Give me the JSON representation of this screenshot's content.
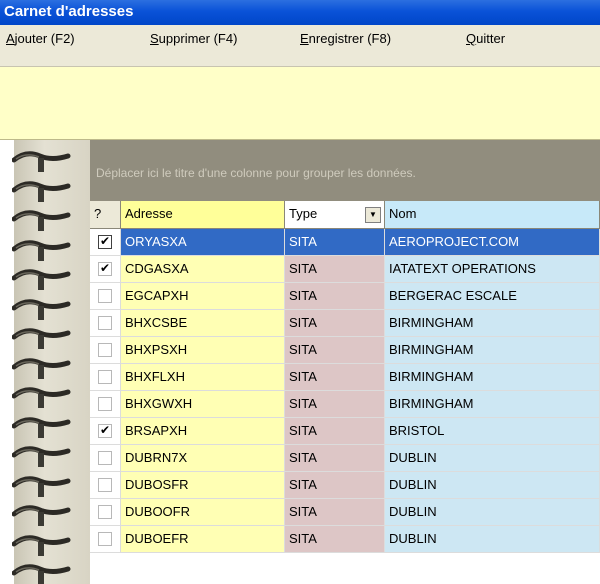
{
  "window": {
    "title": "Carnet d'adresses"
  },
  "menu": [
    {
      "key": "ajouter",
      "ul": "A",
      "rest": "jouter (F2)"
    },
    {
      "key": "supprimer",
      "ul": "S",
      "rest": "upprimer (F4)"
    },
    {
      "key": "enregistrer",
      "ul": "E",
      "rest": "nregistrer (F8)"
    },
    {
      "key": "quitter",
      "ul": "Q",
      "rest": "uitter"
    }
  ],
  "group_hint": "Déplacer ici le titre d'une colonne pour grouper les données.",
  "columns": {
    "check": "?",
    "adresse": "Adresse",
    "type": "Type",
    "nom": "Nom"
  },
  "rows": [
    {
      "checked": true,
      "selected": true,
      "adresse": "ORYASXA",
      "type": "SITA",
      "nom": "AEROPROJECT.COM"
    },
    {
      "checked": true,
      "selected": false,
      "adresse": "CDGASXA",
      "type": "SITA",
      "nom": "IATATEXT OPERATIONS"
    },
    {
      "checked": false,
      "selected": false,
      "adresse": "EGCAPXH",
      "type": "SITA",
      "nom": "BERGERAC ESCALE"
    },
    {
      "checked": false,
      "selected": false,
      "adresse": "BHXCSBE",
      "type": "SITA",
      "nom": "BIRMINGHAM"
    },
    {
      "checked": false,
      "selected": false,
      "adresse": "BHXPSXH",
      "type": "SITA",
      "nom": "BIRMINGHAM"
    },
    {
      "checked": false,
      "selected": false,
      "adresse": "BHXFLXH",
      "type": "SITA",
      "nom": "BIRMINGHAM"
    },
    {
      "checked": false,
      "selected": false,
      "adresse": "BHXGWXH",
      "type": "SITA",
      "nom": "BIRMINGHAM"
    },
    {
      "checked": true,
      "selected": false,
      "adresse": "BRSAPXH",
      "type": "SITA",
      "nom": "BRISTOL"
    },
    {
      "checked": false,
      "selected": false,
      "adresse": "DUBRN7X",
      "type": "SITA",
      "nom": "DUBLIN"
    },
    {
      "checked": false,
      "selected": false,
      "adresse": "DUBOSFR",
      "type": "SITA",
      "nom": "DUBLIN"
    },
    {
      "checked": false,
      "selected": false,
      "adresse": "DUBOOFR",
      "type": "SITA",
      "nom": "DUBLIN"
    },
    {
      "checked": false,
      "selected": false,
      "adresse": "DUBOEFR",
      "type": "SITA",
      "nom": "DUBLIN"
    }
  ],
  "colors": {
    "title_bar": "#0a52d8",
    "selection": "#316ac5",
    "adresse_col": "#ffffb4",
    "type_col": "#ddc6c6",
    "nom_col": "#cde7f3"
  }
}
